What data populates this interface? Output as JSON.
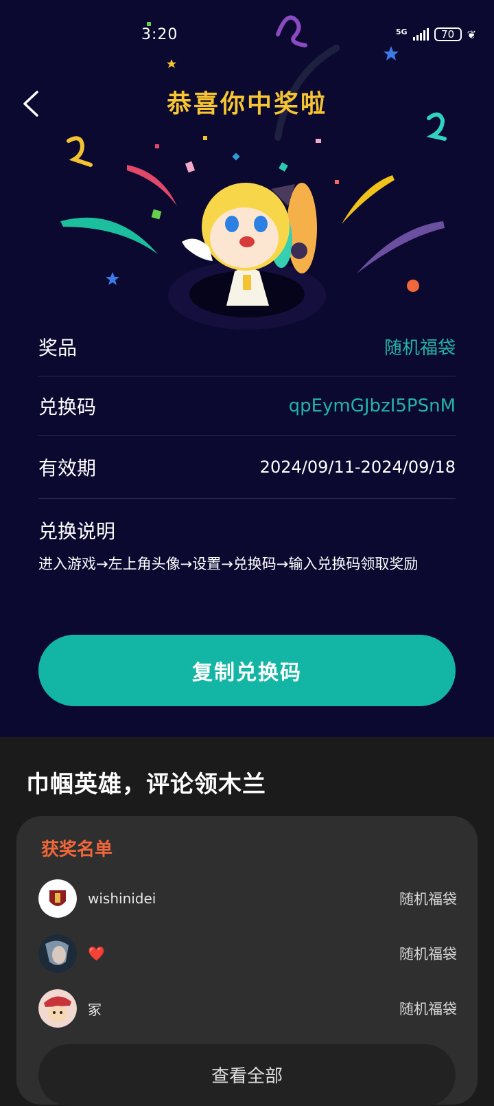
{
  "status": {
    "time": "3:20",
    "network": "5G",
    "battery": "70"
  },
  "header": {
    "title": "恭喜你中奖啦"
  },
  "prize": {
    "prize_label": "奖品",
    "prize_value": "随机福袋",
    "code_label": "兑换码",
    "code_value": "qpEymGJbzI5PSnM",
    "validity_label": "有效期",
    "validity_value": "2024/09/11-2024/09/18",
    "instructions_title": "兑换说明",
    "instructions_text": "进入游戏→左上角头像→设置→兑换码→输入兑换码领取奖励"
  },
  "copy_button": "复制兑换码",
  "section": {
    "title": "巾帼英雄，评论领木兰",
    "winners_title": "获奖名单",
    "winners": [
      {
        "name": "wishinidei",
        "prize": "随机福袋"
      },
      {
        "name": "❤️",
        "prize": "随机福袋"
      },
      {
        "name": "冢",
        "prize": "随机福袋"
      }
    ],
    "more_label": "查看全部"
  },
  "colors": {
    "accent": "#13b6a5",
    "title_gold": "#f7c531",
    "winners_orange": "#f0673a",
    "top_bg": "#0b0930"
  }
}
